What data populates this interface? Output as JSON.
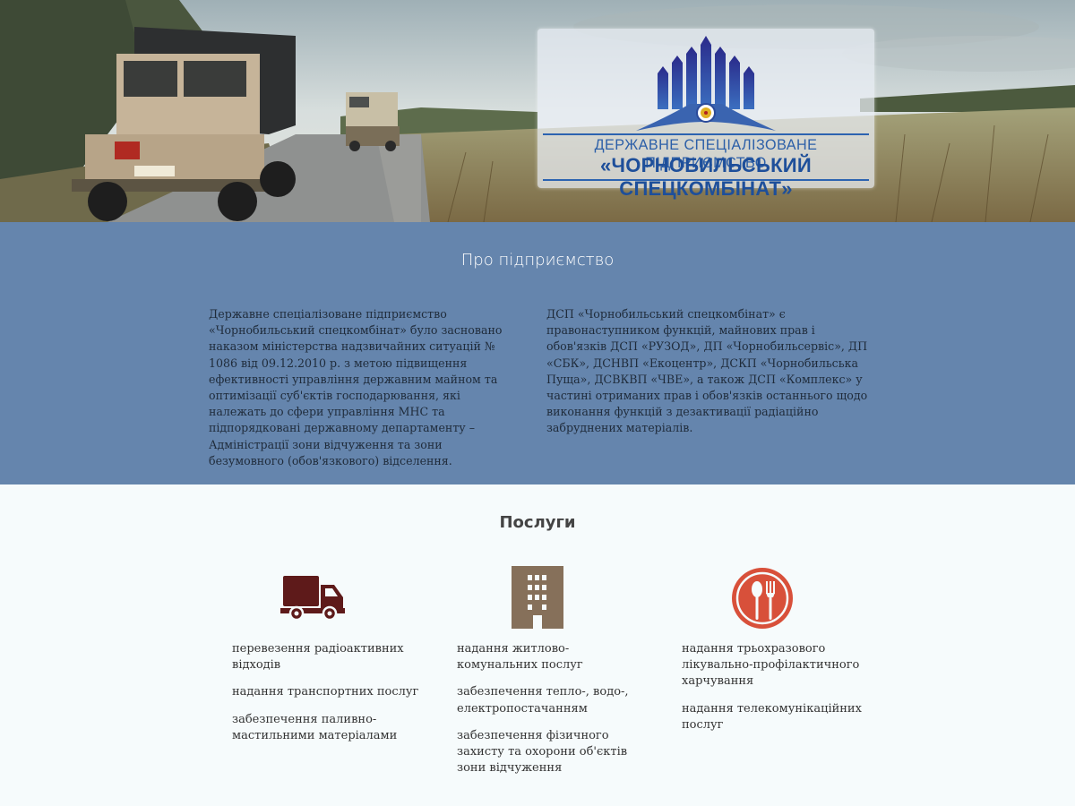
{
  "hero": {
    "logo_line1": "ДЕРЖАВНЕ СПЕЦІАЛІЗОВАНЕ ПІДПРИЄМСТВО",
    "logo_line2": "«ЧОРНОБИЛЬСЬКИЙ СПЕЦКОМБІНАТ»",
    "colors": {
      "logo_blue": "#1e4f9a",
      "sky": "#cfd8d9",
      "field": "#8a7b52"
    }
  },
  "about": {
    "title": "Про підприємство",
    "left_text": "Державне спеціалізоване підприємство «Чорнобильський спецкомбінат» було засновано наказом міністерства надзвичайних ситуацій № 1086 від 09.12.2010 р. з метою підвищення ефективності управління державним майном та оптимізації суб'єктів господарювання, які належать до сфери управління МНС та підпорядковані державному департаменту – Адміністрації зони відчуження та зони безумовного (обов'язкового) відселення.",
    "right_text": "ДСП «Чорнобильський спецкомбінат» є правонаступником функцій, майнових прав і обов'язків ДСП «РУЗОД», ДП «Чорнобильсервіс», ДП «СБК», ДСНВП «Екоцентр», ДСКП «Чорнобильська Пуща», ДСВКВП «ЧВЕ», а також ДСП «Комплекс» у частині отриманих прав і обов'язків останнього щодо виконання функцій з дезактивації радіаційно забруднених матеріалів.",
    "colors": {
      "background": "#6585ad"
    }
  },
  "services": {
    "title": "Послуги",
    "columns": [
      {
        "icon": "truck-icon",
        "color": "#5e1a1a",
        "items": [
          "перевезення радіоактивних відходів",
          "надання транспортних послуг",
          "забезпечення паливно-мастильними матеріалами"
        ]
      },
      {
        "icon": "building-icon",
        "color": "#86705a",
        "items": [
          "надання житлово-комунальних послуг",
          "забезпечення тепло-, водо-, електропостачанням",
          "забезпечення фізичного захисту  та охорони об'єктів зони відчуження"
        ]
      },
      {
        "icon": "dining-icon",
        "color": "#d8503a",
        "items": [
          "надання трьохразового лікувально-профілактичного харчування",
          "надання телекомунікаційних послуг"
        ]
      }
    ]
  }
}
